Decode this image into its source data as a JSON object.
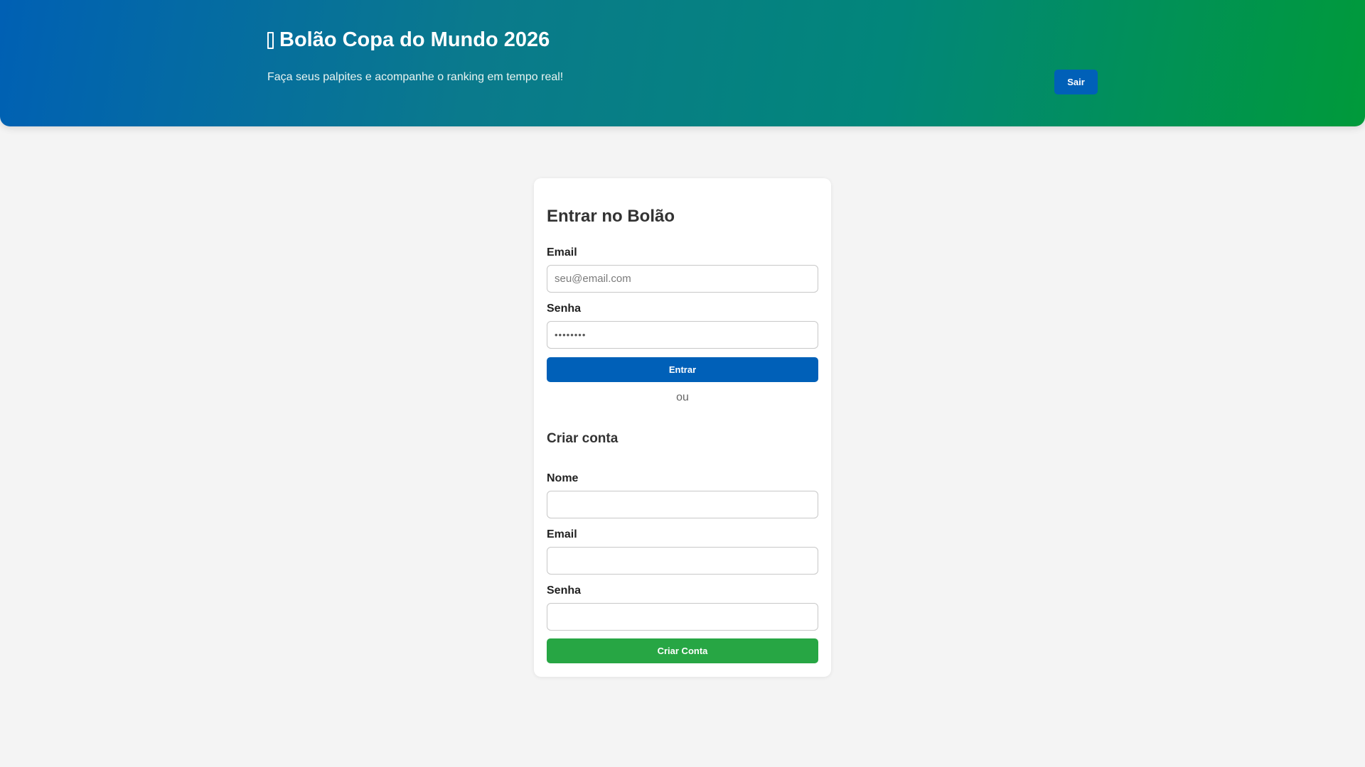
{
  "header": {
    "title": "Bolão Copa do Mundo 2026",
    "subtitle": "Faça seus palpites e acompanhe o ranking em tempo real!",
    "logout_label": "Sair",
    "icon": "trophy-icon"
  },
  "login": {
    "title": "Entrar no Bolão",
    "email_label": "Email",
    "email_placeholder": "seu@email.com",
    "password_label": "Senha",
    "password_value": "••••••••",
    "submit_label": "Entrar"
  },
  "divider": "ou",
  "signup": {
    "title": "Criar conta",
    "name_label": "Nome",
    "email_label": "Email",
    "password_label": "Senha",
    "submit_label": "Criar Conta"
  },
  "colors": {
    "primary": "#0060b8",
    "success": "#27a644",
    "header_gradient_start": "#0060b4",
    "header_gradient_end": "#009a3a",
    "background": "#f4f4f4"
  }
}
